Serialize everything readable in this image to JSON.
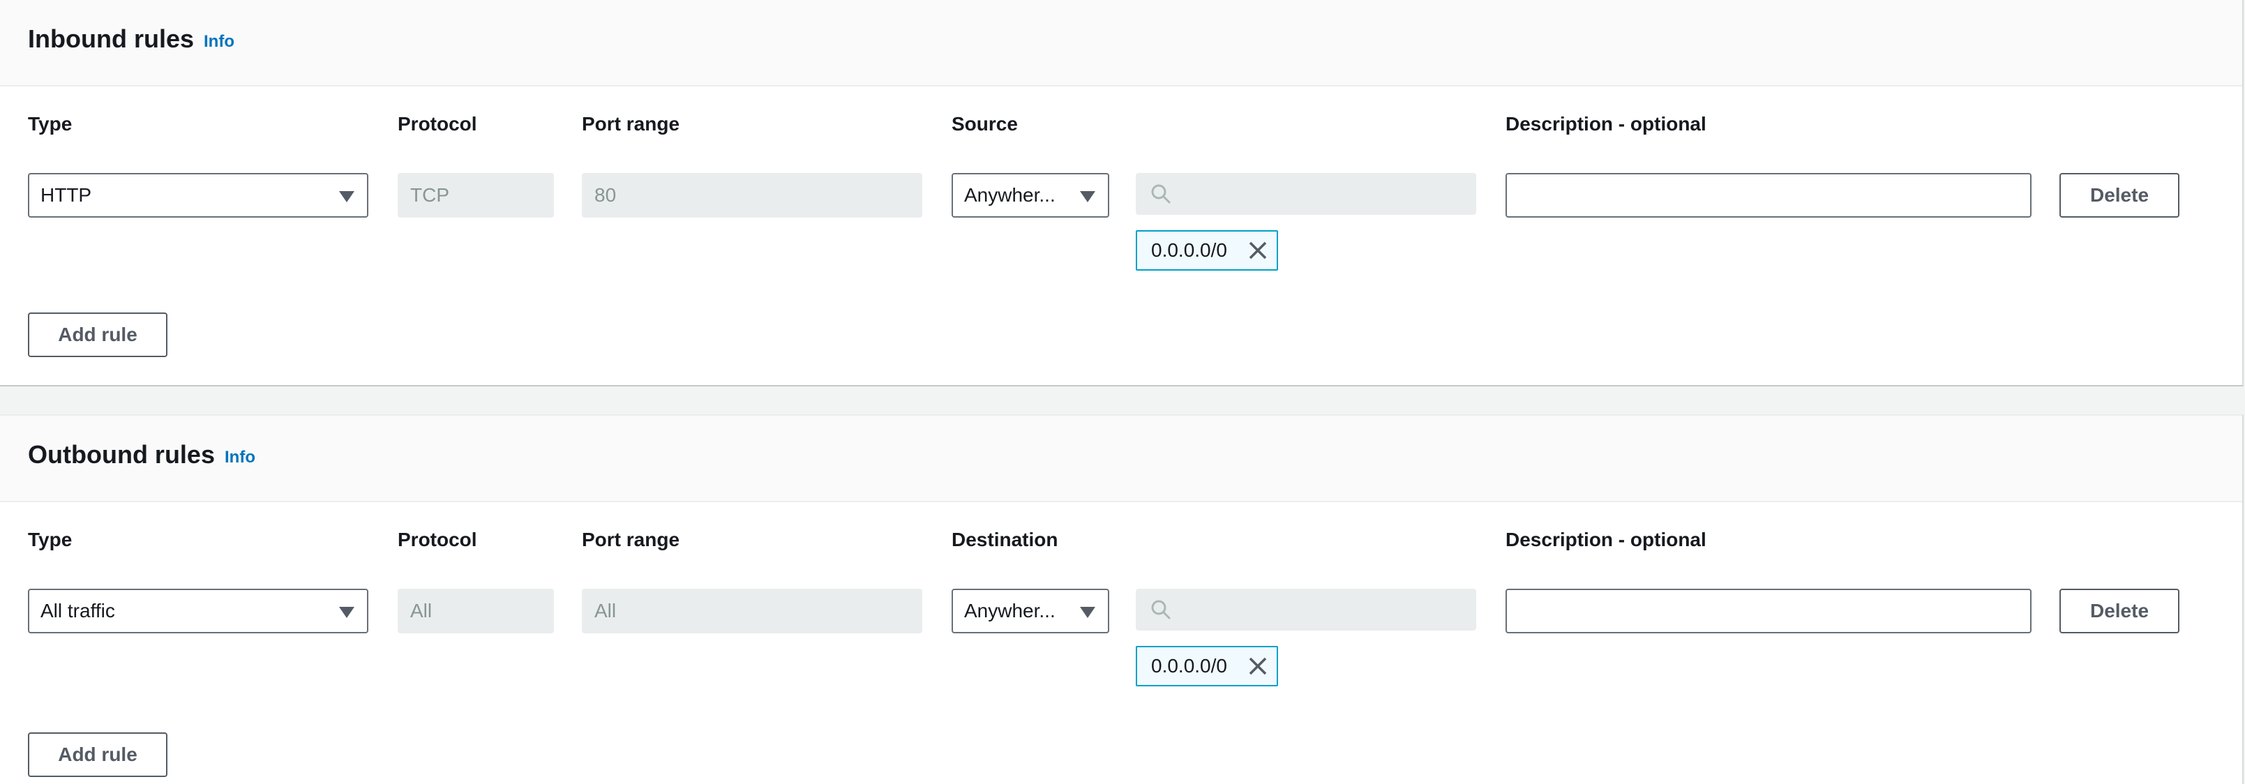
{
  "inbound": {
    "title": "Inbound rules",
    "info": "Info",
    "columns": {
      "type": "Type",
      "protocol": "Protocol",
      "port_range": "Port range",
      "target": "Source",
      "description": "Description - optional"
    },
    "rule": {
      "type": "HTTP",
      "protocol": "TCP",
      "port_range": "80",
      "target_select": "Anywher...",
      "search_placeholder": "",
      "cidr": "0.0.0.0/0",
      "description": ""
    },
    "delete_label": "Delete",
    "add_rule_label": "Add rule"
  },
  "outbound": {
    "title": "Outbound rules",
    "info": "Info",
    "columns": {
      "type": "Type",
      "protocol": "Protocol",
      "port_range": "Port range",
      "target": "Destination",
      "description": "Description - optional"
    },
    "rule": {
      "type": "All traffic",
      "protocol": "All",
      "port_range": "All",
      "target_select": "Anywher...",
      "search_placeholder": "",
      "cidr": "0.0.0.0/0",
      "description": ""
    },
    "delete_label": "Delete",
    "add_rule_label": "Add rule"
  },
  "icons": {
    "dropdown": "caret-down-icon",
    "search": "search-icon",
    "remove": "close-icon"
  },
  "colors": {
    "link": "#0073bb",
    "token_border": "#00a1c9",
    "token_bg": "#f1faff",
    "header_bg": "#fafafa"
  }
}
